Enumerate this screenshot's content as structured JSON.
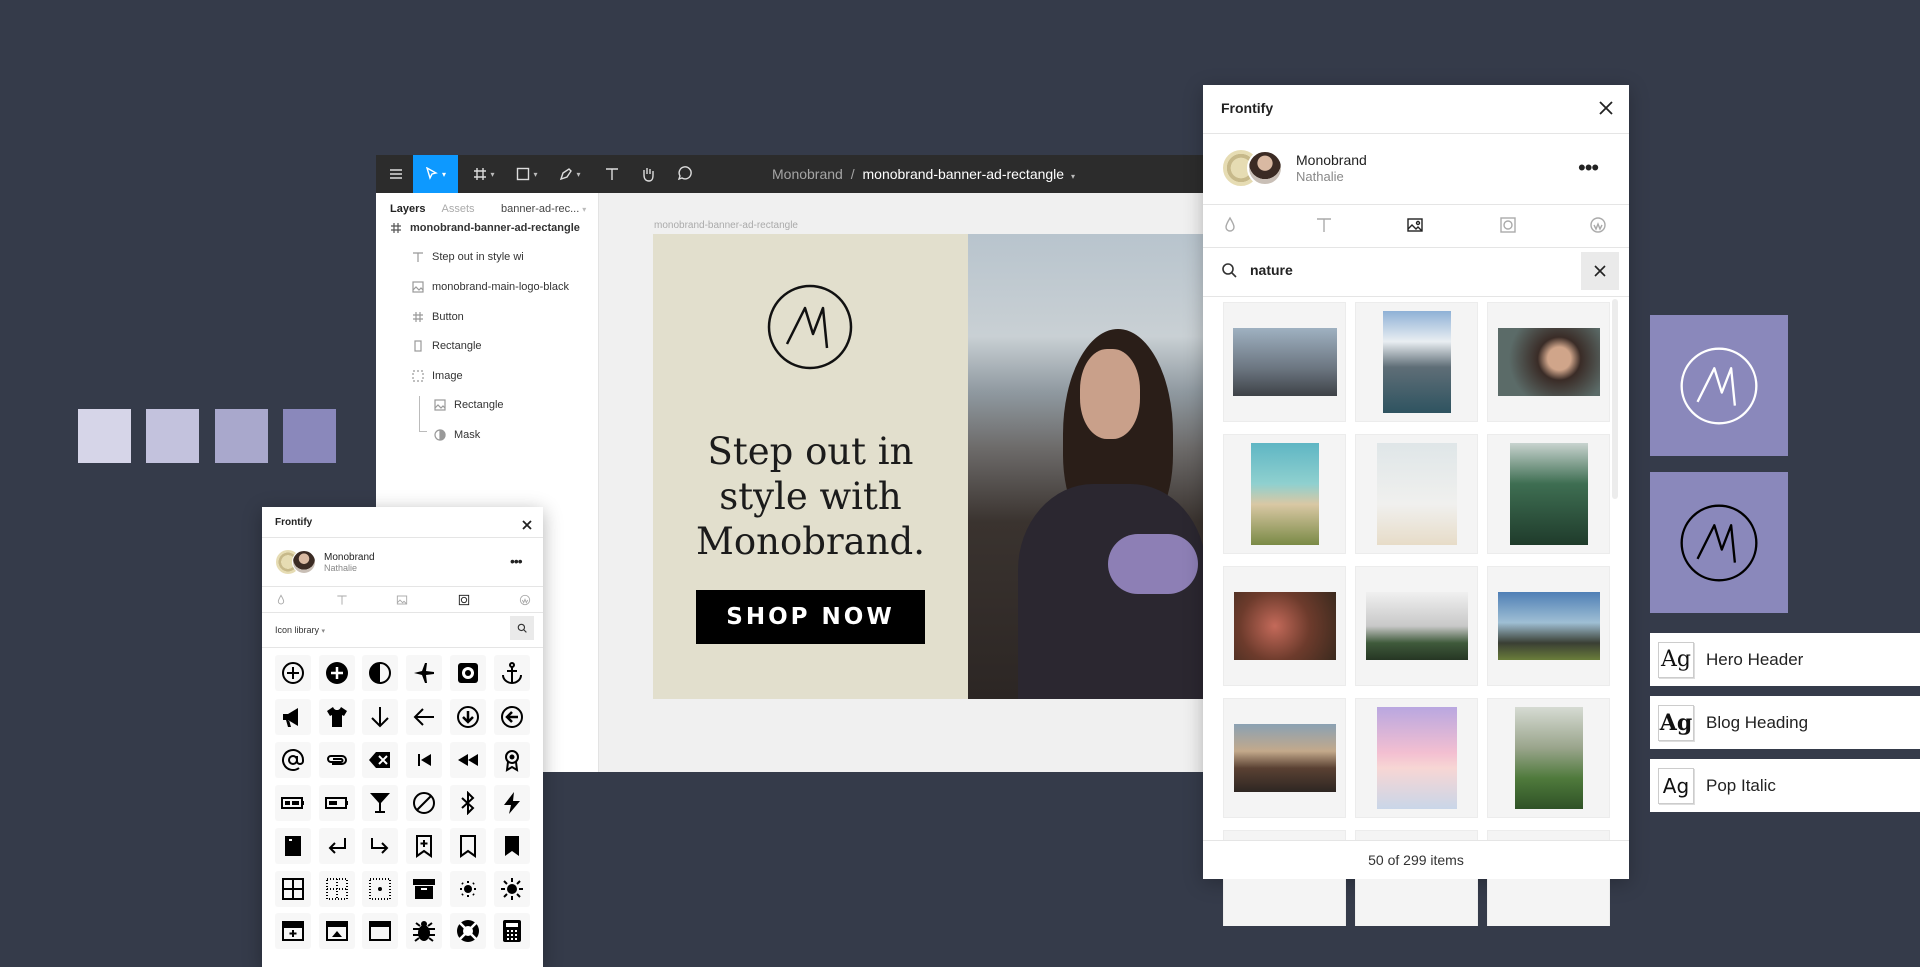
{
  "swatches": [
    "#d6d5e8",
    "#c3c2dd",
    "#a9a8cc",
    "#8a88bb"
  ],
  "figma": {
    "project": "Monobrand",
    "separator": "/",
    "file": "monobrand-banner-ad-rectangle",
    "tabs": {
      "layers": "Layers",
      "assets": "Assets"
    },
    "page": "banner-ad-rec...",
    "canvas_label": "monobrand-banner-ad-rectangle",
    "layers": [
      {
        "label": "monobrand-banner-ad-rectangle",
        "icon": "frame-icon"
      },
      {
        "label": "Step out in style wi",
        "icon": "text-icon"
      },
      {
        "label": "monobrand-main-logo-black",
        "icon": "image-icon"
      },
      {
        "label": "Button",
        "icon": "frame-icon"
      },
      {
        "label": "Rectangle",
        "icon": "rectangle-icon"
      },
      {
        "label": "Image",
        "icon": "group-icon"
      },
      {
        "label": "Rectangle",
        "icon": "image-icon"
      },
      {
        "label": "Mask",
        "icon": "mask-icon"
      }
    ],
    "banner": {
      "headline_1": "Step out in",
      "headline_2": "style with",
      "headline_3": "Monobrand.",
      "cta": "SHOP NOW"
    }
  },
  "frontify_big": {
    "title": "Frontify",
    "brand": "Monobrand",
    "user": "Nathalie",
    "search_value": "nature",
    "status": "50 of 299 items",
    "tabs": [
      "color-icon",
      "typography-icon",
      "media-icon",
      "icon-library-icon",
      "logo-icon"
    ],
    "active_tab": "media-icon"
  },
  "frontify_small": {
    "title": "Frontify",
    "brand": "Monobrand",
    "user": "Nathalie",
    "library": "Icon library"
  },
  "fonts": [
    "Hero Header",
    "Blog Heading",
    "Pop Italic"
  ],
  "font_sample": "Ag"
}
